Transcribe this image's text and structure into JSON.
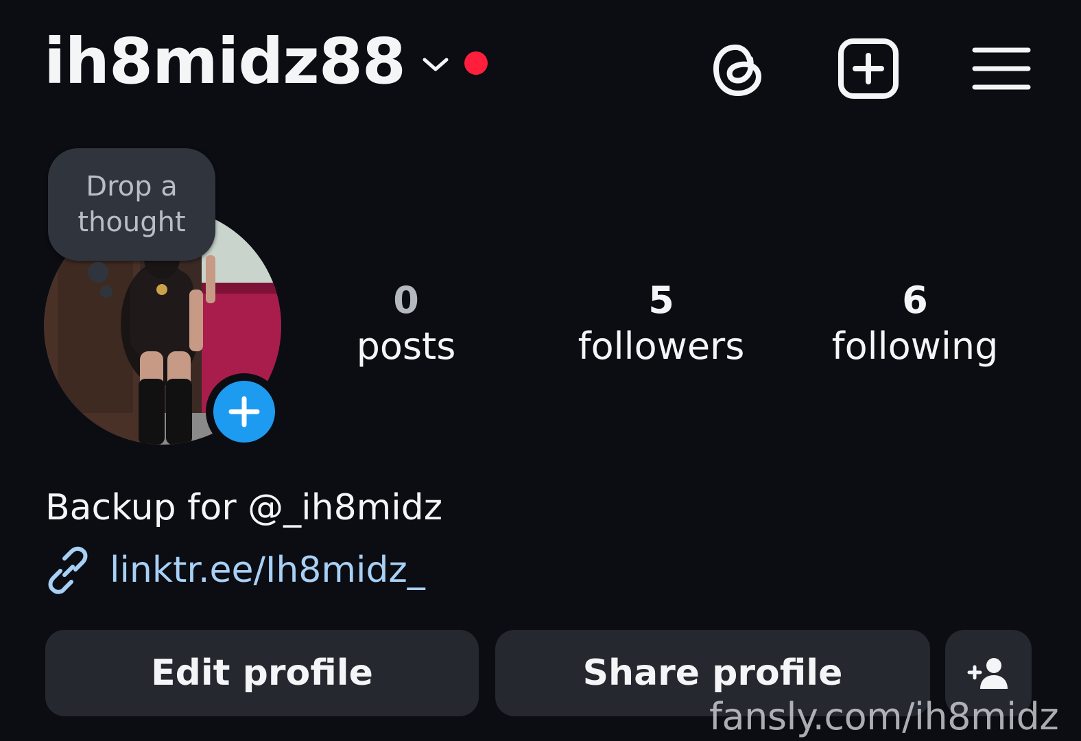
{
  "header": {
    "username": "ih8midz88",
    "icons": {
      "account_switch": "chevron-down-icon",
      "notification": "red-dot",
      "threads": "threads-icon",
      "new_post": "plus-square-icon",
      "menu": "hamburger-menu-icon"
    }
  },
  "note": {
    "line1": "Drop a",
    "line2": "thought"
  },
  "stats": {
    "posts": {
      "value": "0",
      "label": "posts"
    },
    "followers": {
      "value": "5",
      "label": "followers"
    },
    "following": {
      "value": "6",
      "label": "following"
    }
  },
  "bio": {
    "text": "Backup for @_ih8midz",
    "link": "linktr.ee/Ih8midz_"
  },
  "buttons": {
    "edit": "Edit profile",
    "share": "Share profile",
    "discover_icon": "add-person-icon"
  },
  "watermark": "fansly.com/ih8midz",
  "colors": {
    "background": "#0b0d13",
    "accent_blue": "#1d9bf0",
    "link": "#a8d0f5",
    "notification_red": "#ff1f3d",
    "button_bg": "#25282f"
  }
}
